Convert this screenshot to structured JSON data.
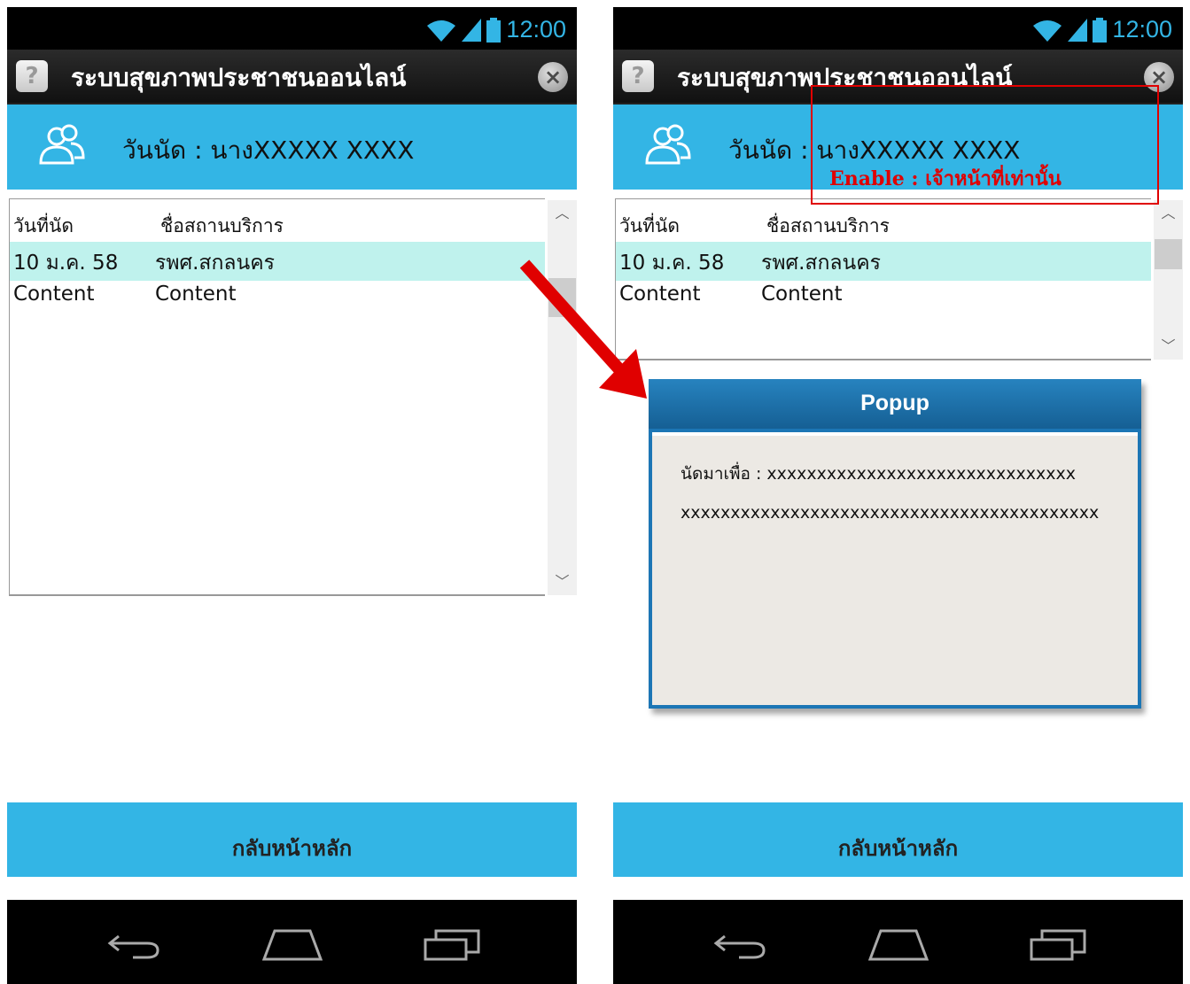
{
  "status": {
    "time": "12:00"
  },
  "app": {
    "title": "ระบบสุขภาพประชาชนออนไลน์",
    "help_symbol": "?",
    "close_symbol": "×"
  },
  "header": {
    "label": "วันนัด : นางXXXXX   XXXX"
  },
  "table": {
    "columns": [
      "วันที่นัด",
      "ชื่อสถานบริการ"
    ],
    "rows": [
      [
        "10 ม.ค. 58",
        "รพศ.สกลนคร"
      ],
      [
        "Content",
        "Content"
      ]
    ]
  },
  "footer": {
    "back_label": "กลับหน้าหลัก"
  },
  "popup": {
    "title": "Popup",
    "line1": "นัดมาเพื่อ : xxxxxxxxxxxxxxxxxxxxxxxxxxxxxxx",
    "line2": "xxxxxxxxxxxxxxxxxxxxxxxxxxxxxxxxxxxxxxxxxx"
  },
  "annotation": {
    "label": "Enable : เจ้าหน้าที่เท่านั้น",
    "color": "#e00000"
  },
  "colors": {
    "accent": "#33b5e5",
    "selected_row": "#bff2ed",
    "popup_header": "#1c76b5"
  },
  "icons": [
    "wifi-icon",
    "signal-icon",
    "battery-icon",
    "help-icon",
    "close-icon",
    "people-icon",
    "back-nav-icon",
    "home-nav-icon",
    "recents-nav-icon",
    "red-arrow"
  ]
}
